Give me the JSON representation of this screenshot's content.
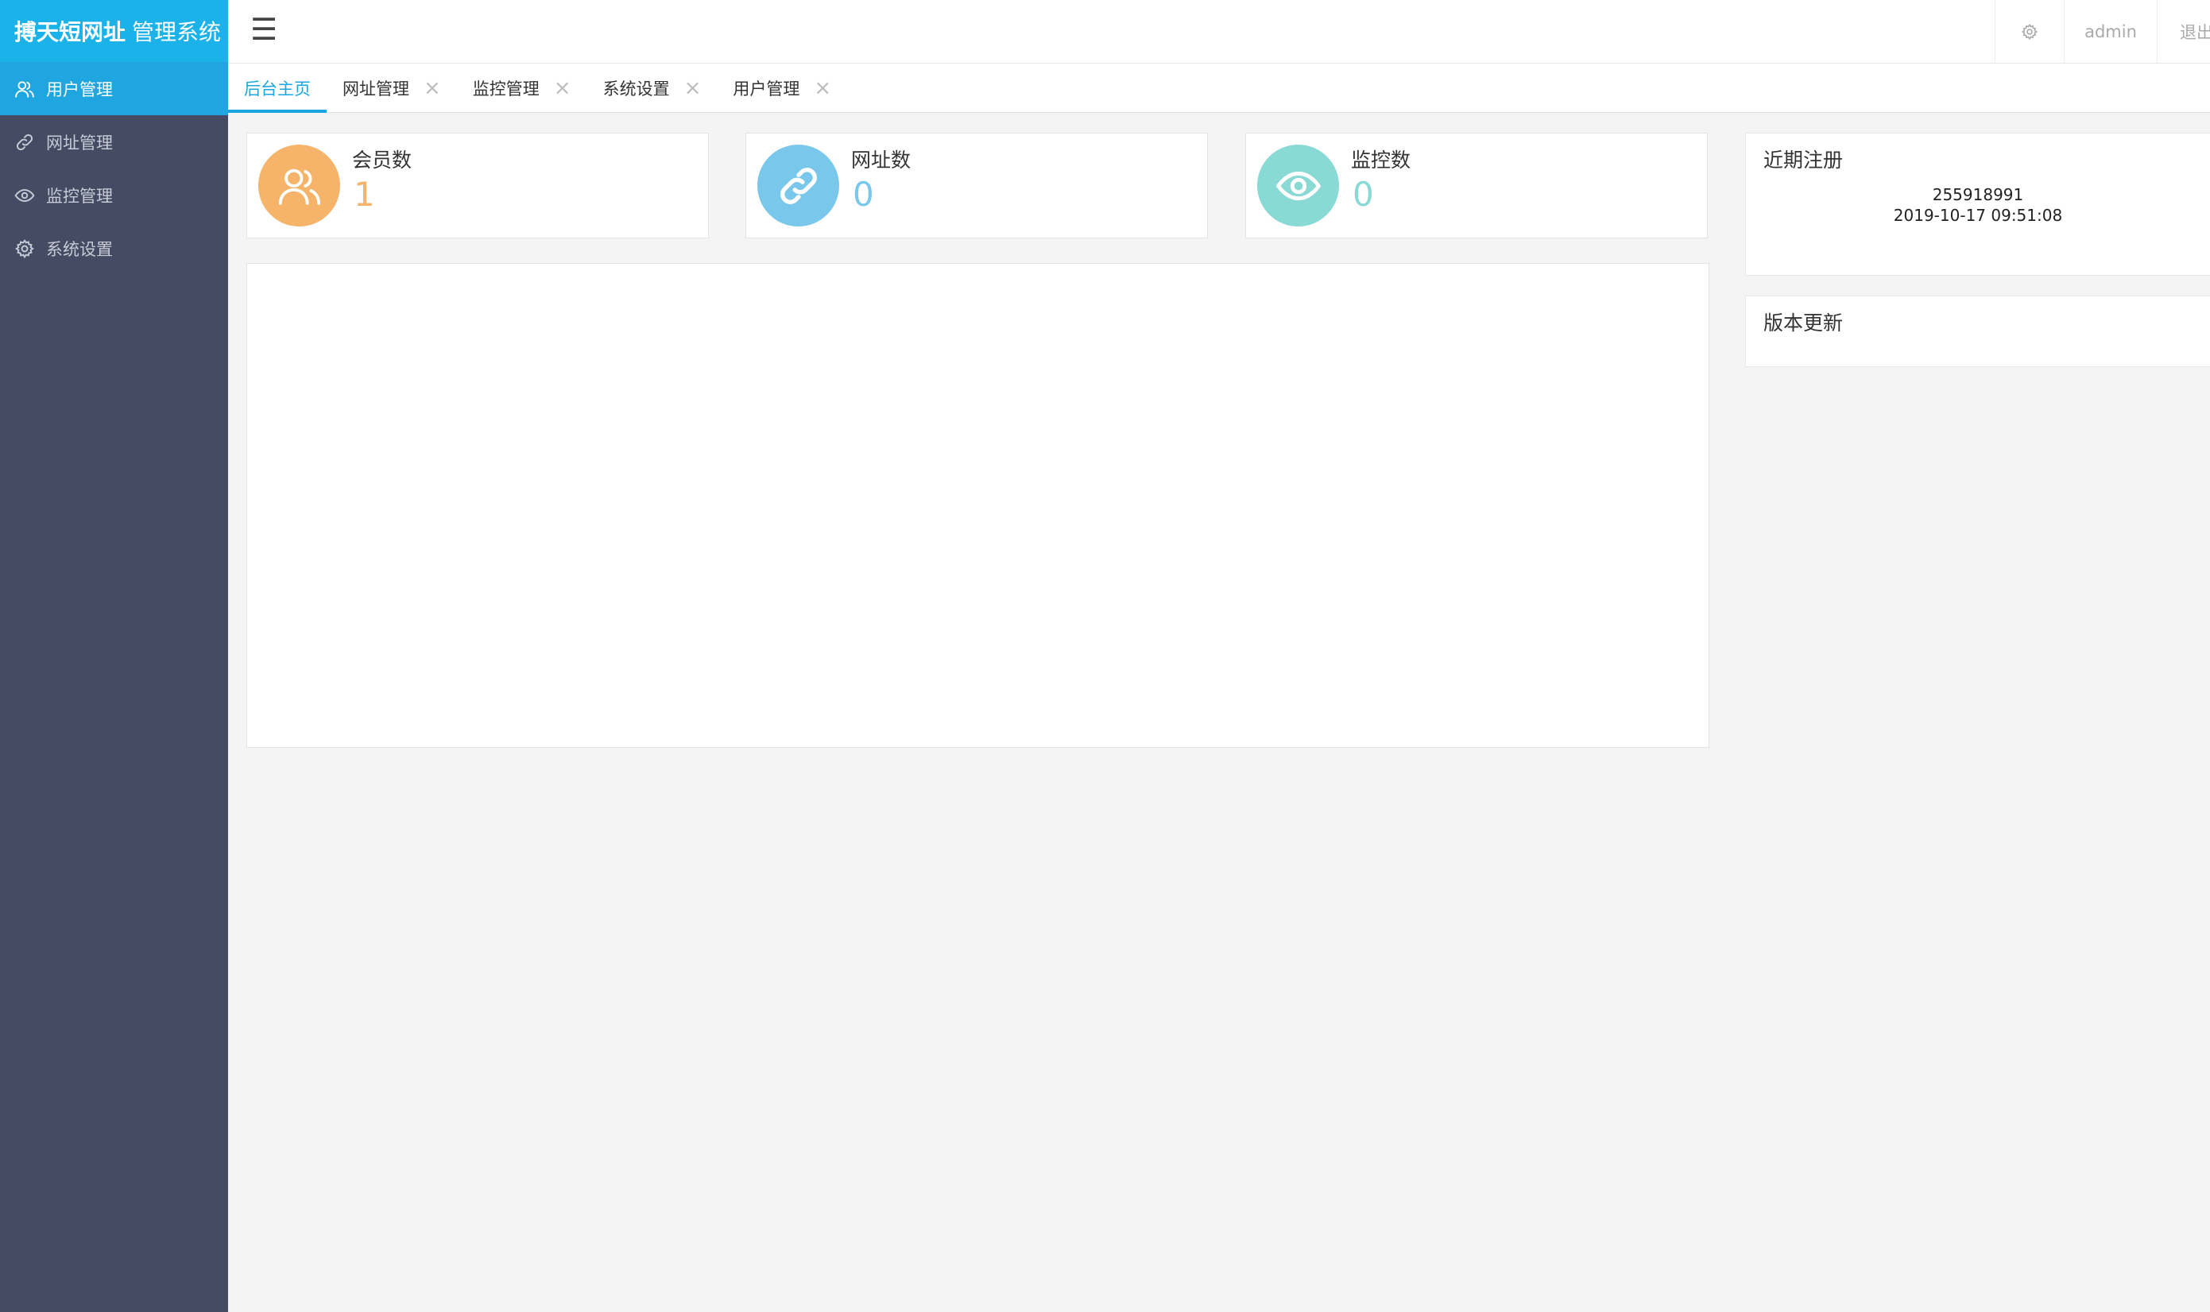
{
  "brand": {
    "strong": "搏天短网址",
    "rest": "管理系统",
    "color": "#1bb1e9"
  },
  "sidebar": {
    "items": [
      {
        "label": "用户管理",
        "icon": "users-icon",
        "active": true
      },
      {
        "label": "网址管理",
        "icon": "link-icon",
        "active": false
      },
      {
        "label": "监控管理",
        "icon": "eye-icon",
        "active": false
      },
      {
        "label": "系统设置",
        "icon": "gear-icon",
        "active": false
      }
    ]
  },
  "header": {
    "menu_glyph": "☰",
    "user": "admin",
    "logout": "退出"
  },
  "tabs": [
    {
      "label": "后台主页",
      "closable": false,
      "active": true
    },
    {
      "label": "网址管理",
      "closable": true,
      "active": false
    },
    {
      "label": "监控管理",
      "closable": true,
      "active": false
    },
    {
      "label": "系统设置",
      "closable": true,
      "active": false
    },
    {
      "label": "用户管理",
      "closable": true,
      "active": false
    }
  ],
  "tab_close_glyph": "×",
  "stats": {
    "members": {
      "label": "会员数",
      "value": "1",
      "color": "#f6b46a"
    },
    "urls": {
      "label": "网址数",
      "value": "0",
      "color": "#79c8ec"
    },
    "monitors": {
      "label": "监控数",
      "value": "0",
      "color": "#89d9d5"
    }
  },
  "recent": {
    "title": "近期注册",
    "entries": [
      {
        "user": "255918991",
        "time": "2019-10-17 09:51:08"
      }
    ]
  },
  "updates": {
    "title": "版本更新"
  }
}
